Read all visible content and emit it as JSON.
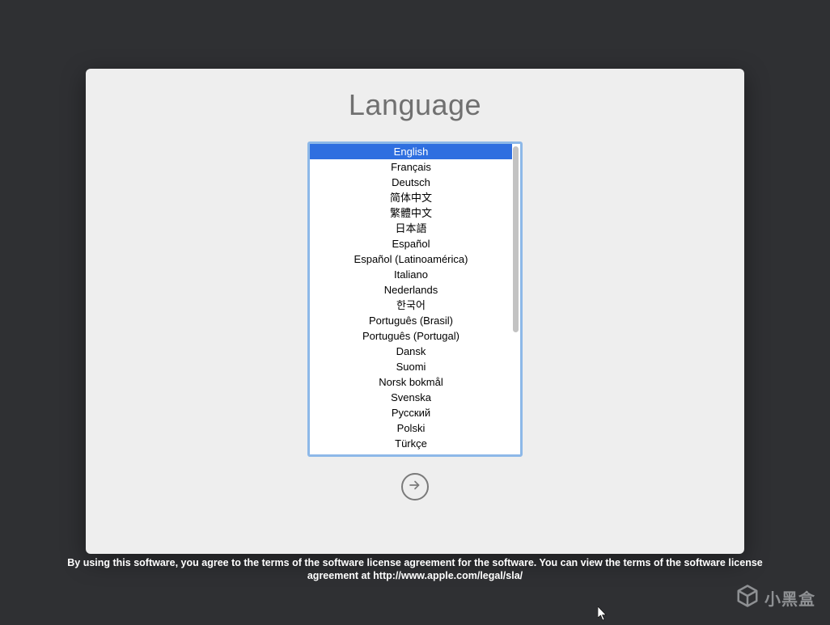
{
  "title": "Language",
  "selected_index": 0,
  "languages": [
    "English",
    "Français",
    "Deutsch",
    "简体中文",
    "繁體中文",
    "日本語",
    "Español",
    "Español (Latinoamérica)",
    "Italiano",
    "Nederlands",
    "한국어",
    "Português (Brasil)",
    "Português (Portugal)",
    "Dansk",
    "Suomi",
    "Norsk bokmål",
    "Svenska",
    "Русский",
    "Polski",
    "Türkçe"
  ],
  "footer_text": "By using this software, you agree to the terms of the software license agreement for the software. You can view the terms of the software license agreement at http://www.apple.com/legal/sla/",
  "watermark_text": "小黑盒"
}
